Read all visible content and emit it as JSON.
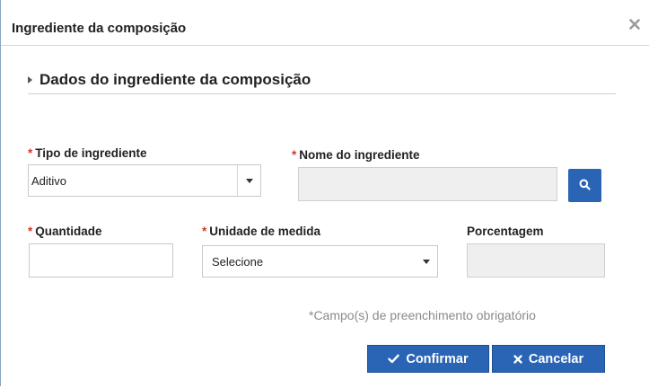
{
  "dialog": {
    "title": "Ingrediente da composição",
    "close_icon": "close-icon"
  },
  "section": {
    "title": "Dados do ingrediente da composição"
  },
  "form": {
    "tipo": {
      "required_mark": "*",
      "label": "Tipo de ingrediente",
      "value": "Aditivo"
    },
    "nome": {
      "required_mark": "*",
      "label": "Nome do ingrediente",
      "value": ""
    },
    "quantidade": {
      "required_mark": "*",
      "label": "Quantidade",
      "value": ""
    },
    "unidade": {
      "required_mark": "*",
      "label": "Unidade de medida",
      "value": "Selecione"
    },
    "porcentagem": {
      "label": "Porcentagem",
      "value": ""
    }
  },
  "note": "*Campo(s) de preenchimento obrigatório",
  "buttons": {
    "confirm": {
      "label": "Confirmar",
      "icon": "check-icon"
    },
    "cancel": {
      "label": "Cancelar",
      "icon": "x-icon"
    }
  },
  "colors": {
    "accent": "#2a64b5",
    "required": "#d9342b",
    "note_text": "#8a8a8a"
  }
}
